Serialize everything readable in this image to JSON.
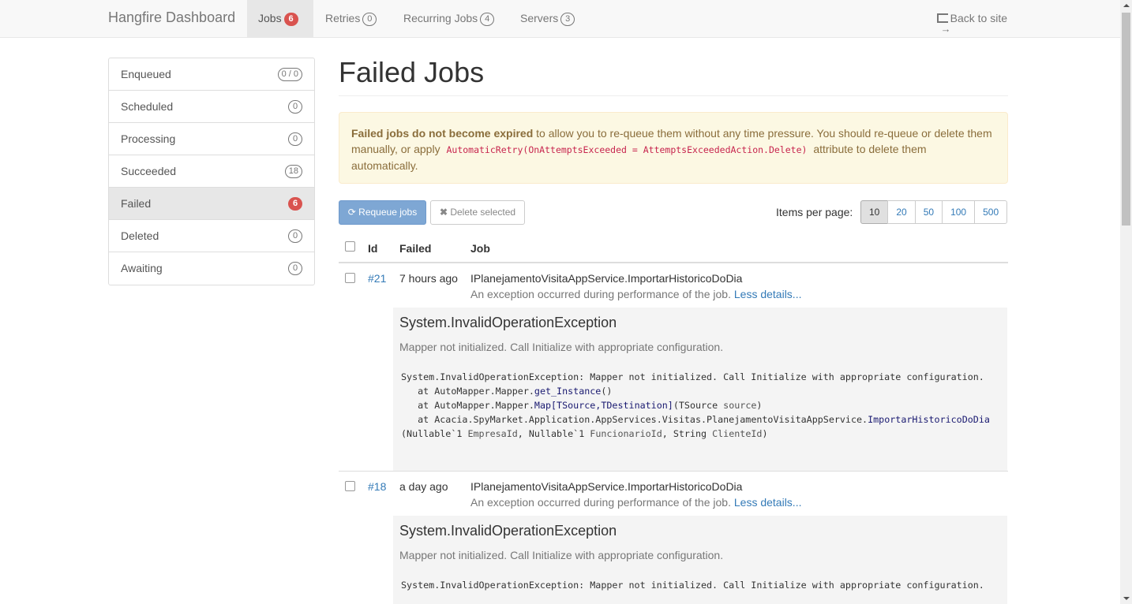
{
  "navbar": {
    "brand": "Hangfire Dashboard",
    "items": [
      {
        "label": "Jobs",
        "badge": "6",
        "active": true
      },
      {
        "label": "Retries",
        "badge": "0"
      },
      {
        "label": "Recurring Jobs",
        "badge": "4"
      },
      {
        "label": "Servers",
        "badge": "3"
      }
    ],
    "back_label": "Back to site"
  },
  "sidebar": {
    "items": [
      {
        "label": "Enqueued",
        "badge": "0 / 0"
      },
      {
        "label": "Scheduled",
        "badge": "0"
      },
      {
        "label": "Processing",
        "badge": "0"
      },
      {
        "label": "Succeeded",
        "badge": "18"
      },
      {
        "label": "Failed",
        "badge": "6",
        "active": true
      },
      {
        "label": "Deleted",
        "badge": "0"
      },
      {
        "label": "Awaiting",
        "badge": "0"
      }
    ]
  },
  "main": {
    "title": "Failed Jobs",
    "alert": {
      "strong": "Failed jobs do not become expired",
      "text1": " to allow you to re-queue them without any time pressure. You should re-queue or delete them manually, or apply ",
      "code": "AutomaticRetry(OnAttemptsExceeded = AttemptsExceededAction.Delete)",
      "text2": " attribute to delete them automatically."
    },
    "requeue_label": "Requeue jobs",
    "delete_label": "Delete selected",
    "items_per_page_label": "Items per page:",
    "page_sizes": [
      "10",
      "20",
      "50",
      "100",
      "500"
    ],
    "columns": {
      "id": "Id",
      "failed": "Failed",
      "job": "Job"
    },
    "jobs": [
      {
        "id": "#21",
        "failed": "7 hours ago",
        "name": "IPlanejamentoVisitaAppService.ImportarHistoricoDoDia",
        "message": "An exception occurred during performance of the job.",
        "details_link": "Less details...",
        "exception_type": "System.InvalidOperationException",
        "exception_message": "Mapper not initialized. Call Initialize with appropriate configuration.",
        "stack": {
          "l1": "System.InvalidOperationException: Mapper not initialized. Call Initialize with appropriate configuration.",
          "l2a": "   at AutoMapper.Mapper.",
          "l2m": "get_Instance",
          "l2b": "()",
          "l3a": "   at AutoMapper.Mapper.",
          "l3m": "Map[TSource,TDestination]",
          "l3b": "(TSource ",
          "l3p": "source",
          "l3c": ")",
          "l4a": "   at Acacia.SpyMarket.Application.AppServices.Visitas.PlanejamentoVisitaAppService.",
          "l4m": "ImportarHistoricoDoDia",
          "l4b": "(Nullable`1 ",
          "l4p1": "EmpresaId",
          "l4c": ", Nullable`1 ",
          "l4p2": "FuncionarioId",
          "l4d": ", String ",
          "l4p3": "ClienteId",
          "l4e": ")"
        }
      },
      {
        "id": "#18",
        "failed": "a day ago",
        "name": "IPlanejamentoVisitaAppService.ImportarHistoricoDoDia",
        "message": "An exception occurred during performance of the job.",
        "details_link": "Less details...",
        "exception_type": "System.InvalidOperationException",
        "exception_message": "Mapper not initialized. Call Initialize with appropriate configuration.",
        "stack": {
          "l1": "System.InvalidOperationException: Mapper not initialized. Call Initialize with appropriate configuration."
        }
      }
    ]
  }
}
